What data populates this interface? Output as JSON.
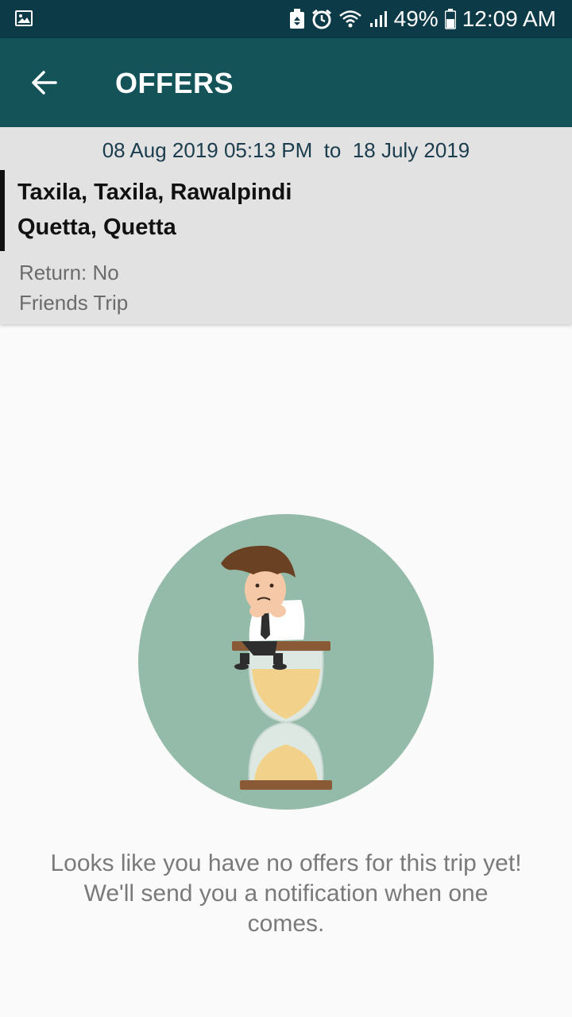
{
  "status_bar": {
    "battery_percent": "49%",
    "time": "12:09 AM",
    "icons": [
      "gallery-icon",
      "recycle-icon",
      "alarm-icon",
      "wifi-icon",
      "signal-icon",
      "battery-icon"
    ]
  },
  "app_bar": {
    "title": "OFFERS",
    "back_icon": "arrow-left-icon"
  },
  "trip": {
    "dates": "08 Aug 2019 05:13 PM  to  18 July 2019",
    "from": "Taxila, Taxila, Rawalpindi",
    "to": "Quetta, Quetta",
    "return": "Return: No",
    "type": "Friends Trip"
  },
  "empty_state": {
    "illustration": "waiting-man-on-hourglass",
    "message": "Looks like you have no offers for this trip yet! We'll send you a notification when one comes."
  },
  "colors": {
    "status_bar": "#0d3a47",
    "app_bar": "#145458",
    "card_bg": "#e2e2e2",
    "illustration_circle": "#94bba9"
  }
}
